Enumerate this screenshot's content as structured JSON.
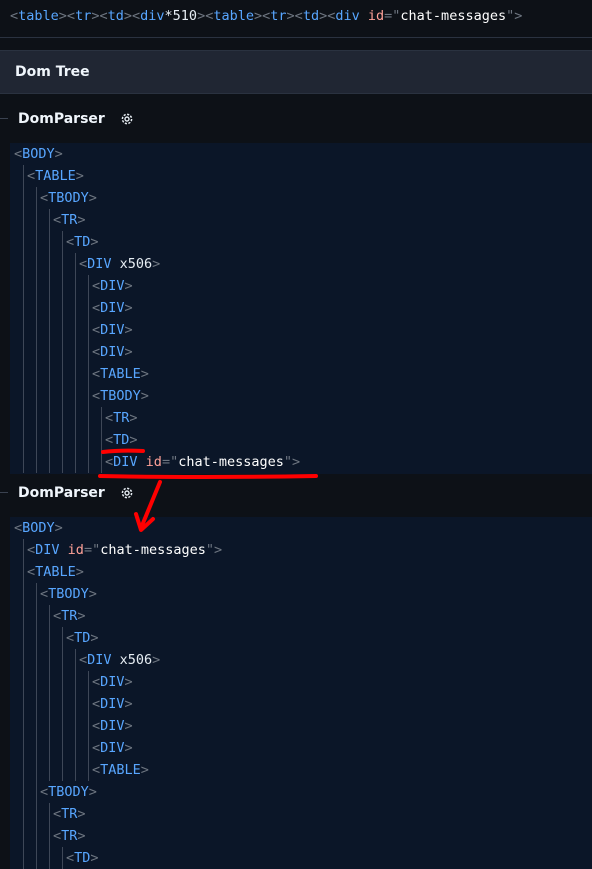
{
  "colors": {
    "background": "#0d1117",
    "panel": "#0b1628",
    "tag": "#58a6ff",
    "bracket": "#6e7681",
    "attr": "#ffa198",
    "annotation_red": "#ff0000"
  },
  "code_line": {
    "tokens": [
      {
        "t": "<",
        "c": "brk"
      },
      {
        "t": "table",
        "c": "tag"
      },
      {
        "t": ">",
        "c": "brk"
      },
      {
        "t": "<",
        "c": "brk"
      },
      {
        "t": "tr",
        "c": "tag"
      },
      {
        "t": ">",
        "c": "brk"
      },
      {
        "t": "<",
        "c": "brk"
      },
      {
        "t": "td",
        "c": "tag"
      },
      {
        "t": ">",
        "c": "brk"
      },
      {
        "t": "<",
        "c": "brk"
      },
      {
        "t": "div",
        "c": "tag"
      },
      {
        "t": "*510",
        "c": "cnt"
      },
      {
        "t": ">",
        "c": "brk"
      },
      {
        "t": "<",
        "c": "brk"
      },
      {
        "t": "table",
        "c": "tag"
      },
      {
        "t": ">",
        "c": "brk"
      },
      {
        "t": "<",
        "c": "brk"
      },
      {
        "t": "tr",
        "c": "tag"
      },
      {
        "t": ">",
        "c": "brk"
      },
      {
        "t": "<",
        "c": "brk"
      },
      {
        "t": "td",
        "c": "tag"
      },
      {
        "t": ">",
        "c": "brk"
      },
      {
        "t": "<",
        "c": "brk"
      },
      {
        "t": "div",
        "c": "tag"
      },
      {
        "t": " ",
        "c": "cnt"
      },
      {
        "t": "id",
        "c": "attr"
      },
      {
        "t": "=\"",
        "c": "brk"
      },
      {
        "t": "chat-messages",
        "c": "val"
      },
      {
        "t": "\"",
        "c": "brk"
      },
      {
        "t": ">",
        "c": "brk"
      }
    ]
  },
  "dom_tree": {
    "title": "Dom Tree"
  },
  "parsers": [
    {
      "title": "DomParser",
      "gear_icon": "gear-icon",
      "rows": [
        {
          "depth": 0,
          "tag": "BODY"
        },
        {
          "depth": 1,
          "tag": "TABLE"
        },
        {
          "depth": 2,
          "tag": "TBODY"
        },
        {
          "depth": 3,
          "tag": "TR"
        },
        {
          "depth": 4,
          "tag": "TD"
        },
        {
          "depth": 5,
          "tag": "DIV",
          "suffix": " x506"
        },
        {
          "depth": 6,
          "tag": "DIV"
        },
        {
          "depth": 6,
          "tag": "DIV"
        },
        {
          "depth": 6,
          "tag": "DIV"
        },
        {
          "depth": 6,
          "tag": "DIV"
        },
        {
          "depth": 6,
          "tag": "TABLE"
        },
        {
          "depth": 6,
          "tag": "TBODY"
        },
        {
          "depth": 7,
          "tag": "TR"
        },
        {
          "depth": 7,
          "tag": "TD"
        },
        {
          "depth": 7,
          "tag": "DIV",
          "attr": "id",
          "value": "chat-messages"
        }
      ]
    },
    {
      "title": "DomParser",
      "gear_icon": "gear-icon",
      "rows": [
        {
          "depth": 0,
          "tag": "BODY"
        },
        {
          "depth": 1,
          "tag": "DIV",
          "attr": "id",
          "value": "chat-messages"
        },
        {
          "depth": 1,
          "tag": "TABLE"
        },
        {
          "depth": 2,
          "tag": "TBODY"
        },
        {
          "depth": 3,
          "tag": "TR"
        },
        {
          "depth": 4,
          "tag": "TD"
        },
        {
          "depth": 5,
          "tag": "DIV",
          "suffix": " x506"
        },
        {
          "depth": 6,
          "tag": "DIV"
        },
        {
          "depth": 6,
          "tag": "DIV"
        },
        {
          "depth": 6,
          "tag": "DIV"
        },
        {
          "depth": 6,
          "tag": "DIV"
        },
        {
          "depth": 6,
          "tag": "TABLE"
        },
        {
          "depth": 2,
          "tag": "TBODY"
        },
        {
          "depth": 3,
          "tag": "TR"
        },
        {
          "depth": 3,
          "tag": "TR"
        },
        {
          "depth": 4,
          "tag": "TD"
        }
      ]
    }
  ]
}
